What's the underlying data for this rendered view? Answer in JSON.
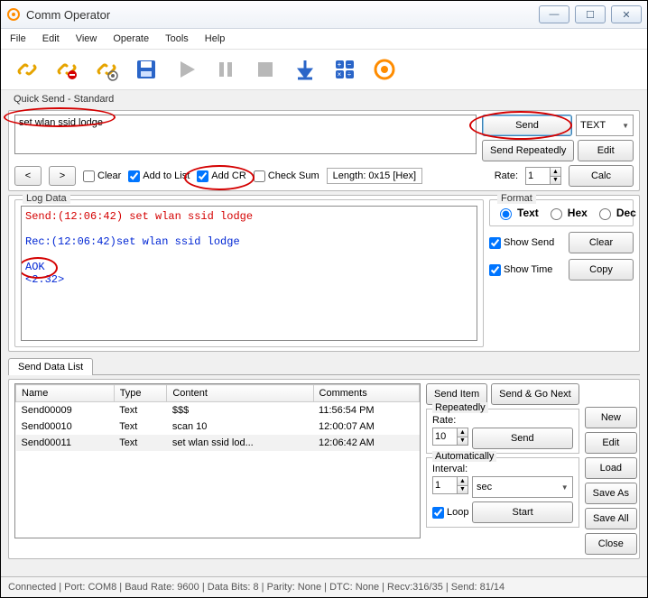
{
  "window": {
    "title": "Comm Operator"
  },
  "menu": [
    "File",
    "Edit",
    "View",
    "Operate",
    "Tools",
    "Help"
  ],
  "quickSend": {
    "label": "Quick Send - Standard",
    "text": "set wlan ssid lodge",
    "sendBtn": "Send",
    "textBtn": "TEXT",
    "sendRepeat": "Send Repeatedly",
    "editBtn": "Edit",
    "clear": "Clear",
    "addToList": "Add to List",
    "addCR": "Add CR",
    "checkSum": "Check Sum",
    "length": "Length: 0x15 [Hex]",
    "rateLabel": "Rate:",
    "rateValue": "1",
    "calc": "Calc"
  },
  "log": {
    "legend": "Log Data",
    "lines": {
      "send": "Send:(12:06:42) set wlan ssid lodge",
      "rec": "Rec:(12:06:42)set wlan ssid lodge",
      "aok": "AOK",
      "ver": "<2.32>"
    },
    "format": {
      "legend": "Format",
      "text": "Text",
      "hex": "Hex",
      "dec": "Dec"
    },
    "showSend": "Show Send",
    "showTime": "Show Time",
    "clear": "Clear",
    "copy": "Copy"
  },
  "dataList": {
    "tab": "Send Data List",
    "cols": [
      "Name",
      "Type",
      "Content",
      "Comments"
    ],
    "rows": [
      {
        "name": "Send00009",
        "type": "Text",
        "content": "$$$",
        "comments": "11:56:54 PM"
      },
      {
        "name": "Send00010",
        "type": "Text",
        "content": "scan 10",
        "comments": "12:00:07 AM"
      },
      {
        "name": "Send00011",
        "type": "Text",
        "content": "set wlan ssid lod...",
        "comments": "12:06:42 AM"
      }
    ],
    "sendItem": "Send Item",
    "sendGo": "Send & Go Next",
    "repeatedly": {
      "legend": "Repeatedly",
      "rate": "Rate:",
      "rateVal": "10",
      "send": "Send"
    },
    "auto": {
      "legend": "Automatically",
      "interval": "Interval:",
      "intVal": "1",
      "unit": "sec",
      "loop": "Loop",
      "start": "Start"
    },
    "new": "New",
    "edit": "Edit",
    "load": "Load",
    "saveAs": "Save As",
    "saveAll": "Save All",
    "close": "Close"
  },
  "status": "Connected | Port: COM8 | Baud Rate: 9600 | Data Bits: 8 | Parity: None | DTC: None | Recv:316/35 | Send: 81/14"
}
